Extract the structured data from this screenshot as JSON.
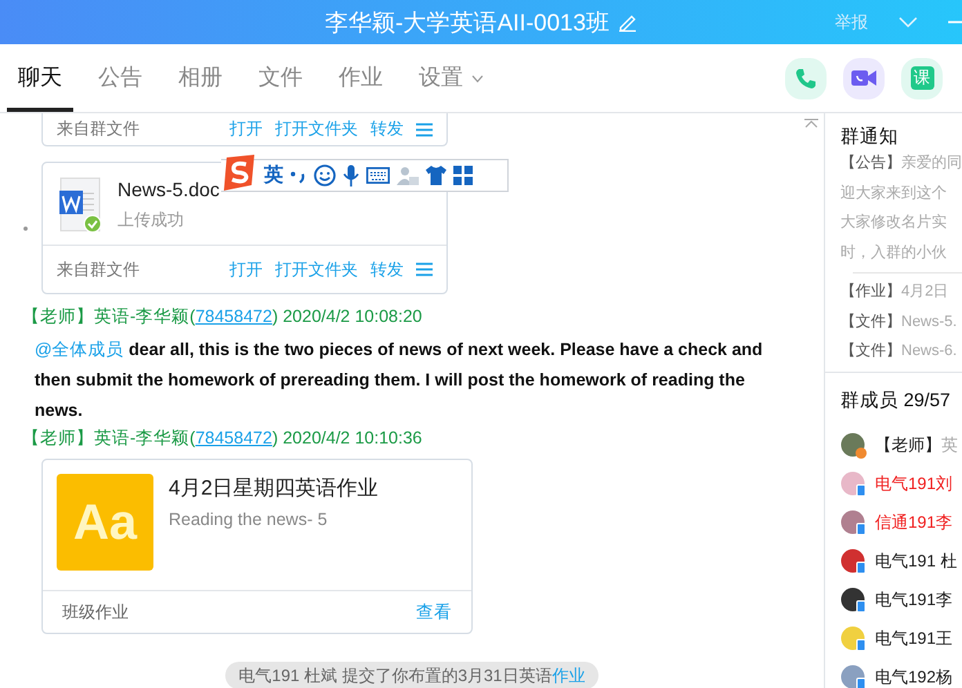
{
  "title_bar": {
    "title": "李华颖-大学英语AII-0013班",
    "report": "举报"
  },
  "tabs": [
    {
      "label": "聊天",
      "selected": true,
      "dropdown": false
    },
    {
      "label": "公告",
      "selected": false,
      "dropdown": false
    },
    {
      "label": "相册",
      "selected": false,
      "dropdown": false
    },
    {
      "label": "文件",
      "selected": false,
      "dropdown": false
    },
    {
      "label": "作业",
      "selected": false,
      "dropdown": false
    },
    {
      "label": "设置",
      "selected": false,
      "dropdown": true
    }
  ],
  "tool_buttons": [
    {
      "kind": "phone"
    },
    {
      "kind": "video"
    },
    {
      "kind": "course",
      "label": "课"
    }
  ],
  "messages": [
    {
      "kind": "file_footer",
      "source": "来自群文件",
      "actions": [
        "打开",
        "打开文件夹",
        "转发"
      ]
    },
    {
      "kind": "file_card",
      "name": "News-5.doc",
      "status": "上传成功",
      "source": "来自群文件",
      "actions": [
        "打开",
        "打开文件夹",
        "转发"
      ]
    },
    {
      "kind": "sender",
      "role": "【老师】",
      "name": "英语-李华颖",
      "open": "(",
      "id": "78458472",
      "close": ")",
      "time": "2020/4/2 10:08:20"
    },
    {
      "kind": "text",
      "mention": "@全体成员",
      "body": "dear all, this is the two pieces of news of next week. Please have a check and then submit the homework of prereading them. I will post the homework of reading the news."
    },
    {
      "kind": "sender",
      "role": "【老师】",
      "name": "英语-李华颖",
      "open": "(",
      "id": "78458472",
      "close": ")",
      "time": "2020/4/2 10:10:36"
    },
    {
      "kind": "homework_card",
      "icon_text": "Aa",
      "title": "4月2日星期四英语作业",
      "subtitle": "Reading the news- 5",
      "footer": "班级作业",
      "action": "查看"
    },
    {
      "kind": "notice",
      "text": "电气191 杜斌 提交了你布置的3月31日英语",
      "link": "作业"
    }
  ],
  "ime_toolbar": {
    "mode": "英"
  },
  "side_panel": {
    "notice_title": "群通知",
    "notices": [
      {
        "tag": "【公告】",
        "lines": [
          "亲爱的同",
          "迎大家来到这个",
          "大家修改名片实",
          "时，入群的小伙"
        ]
      },
      {
        "tag": "【作业】",
        "lines": [
          "4月2日"
        ]
      },
      {
        "tag": "【文件】",
        "lines": [
          "News-5."
        ]
      },
      {
        "tag": "【文件】",
        "lines": [
          "News-6."
        ]
      }
    ],
    "members_title": "群成员 29/57",
    "members": [
      {
        "kind": "teacher",
        "role": "【老师】",
        "name": "英",
        "highlighted": false
      },
      {
        "kind": "student",
        "name": "电气191刘",
        "highlighted": true
      },
      {
        "kind": "student",
        "name": "信通191李",
        "highlighted": true
      },
      {
        "kind": "student",
        "name": "电气191 杜",
        "highlighted": false
      },
      {
        "kind": "student",
        "name": "电气191李",
        "highlighted": false
      },
      {
        "kind": "student",
        "name": "电气191王",
        "highlighted": false
      },
      {
        "kind": "student",
        "name": "电气192杨",
        "highlighted": false
      }
    ]
  }
}
